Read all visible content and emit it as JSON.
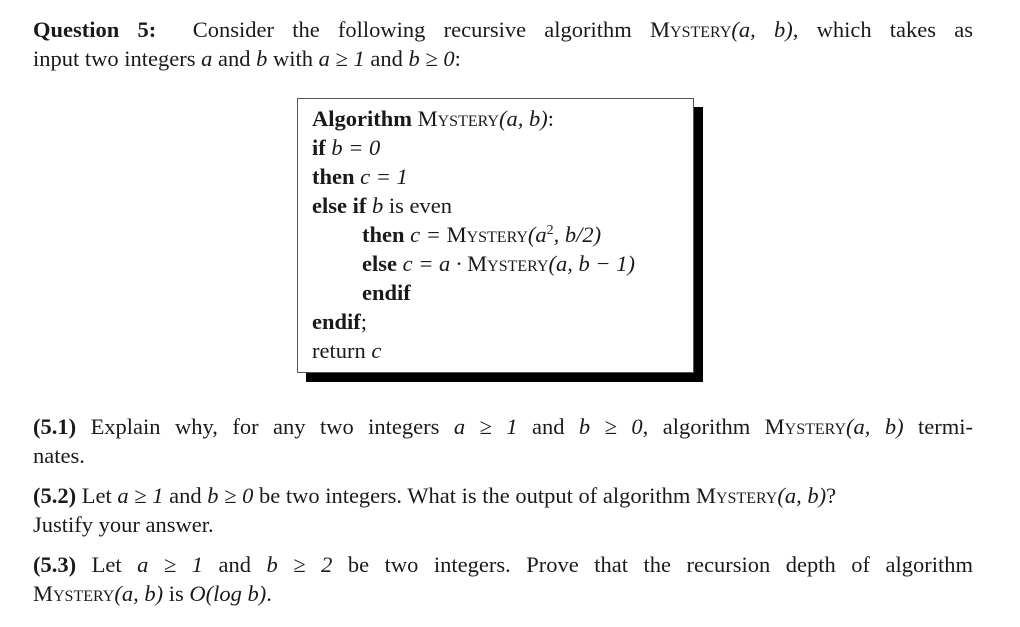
{
  "question": {
    "label": "Question 5:",
    "intro_line1": "Consider the following recursive algorithm",
    "func_name": "Mystery",
    "args": "(a, b)",
    "intro_line1_end": ", which takes as",
    "intro_line2_a": "input two integers ",
    "var_a": "a",
    "and": " and ",
    "var_b": "b",
    "with": " with ",
    "cond_a": "a ≥ 1",
    "cond_b": "b ≥ 0",
    "intro_line2_end": ":"
  },
  "algorithm": {
    "header_kw": "Algorithm",
    "header_name": "Mystery",
    "header_args": "(a, b)",
    "header_colon": ":",
    "lines": [
      {
        "kw": "if",
        "expr": "b = 0"
      },
      {
        "kw": "then",
        "expr": "c = 1"
      },
      {
        "kw": "else if",
        "expr": "b",
        "tail": " is even"
      },
      {
        "kw": "then",
        "expr_pre": "c = ",
        "name": "Mystery",
        "expr_post_a": "(a",
        "sup": "2",
        "expr_post_b": ", b/2)"
      },
      {
        "kw": "else",
        "expr_pre": "c = a · ",
        "name": "Mystery",
        "expr_post": "(a, b − 1)"
      },
      {
        "kw": "endif"
      },
      {
        "kw": "endif",
        "tail": ";"
      },
      {
        "plain": "return ",
        "expr": "c"
      }
    ]
  },
  "subquestions": [
    {
      "label": "(5.1)",
      "line1": " Explain why, for any two integers ",
      "cond1": "a ≥ 1",
      "and": " and ",
      "cond2": "b ≥ 0",
      "mid": ", algorithm ",
      "name": "Mystery",
      "args": "(a, b)",
      "end1": " termi-",
      "line2": "nates."
    },
    {
      "label": "(5.2)",
      "line1a": " Let ",
      "cond1": "a ≥ 1",
      "and": " and ",
      "cond2": "b ≥ 0",
      "line1b": " be two integers. What is the output of algorithm ",
      "name": "Mystery",
      "args": "(a, b)",
      "end1": "?",
      "line2": "Justify your answer."
    },
    {
      "label": "(5.3)",
      "line1a": " Let ",
      "cond1": "a ≥ 1",
      "and": " and ",
      "cond2": "b ≥ 2",
      "line1b": " be two integers. Prove that the recursion depth of algorithm",
      "name": "Mystery",
      "args": "(a, b)",
      "line2a": " is ",
      "bigo": "O(log b)",
      "line2b": "."
    }
  ]
}
